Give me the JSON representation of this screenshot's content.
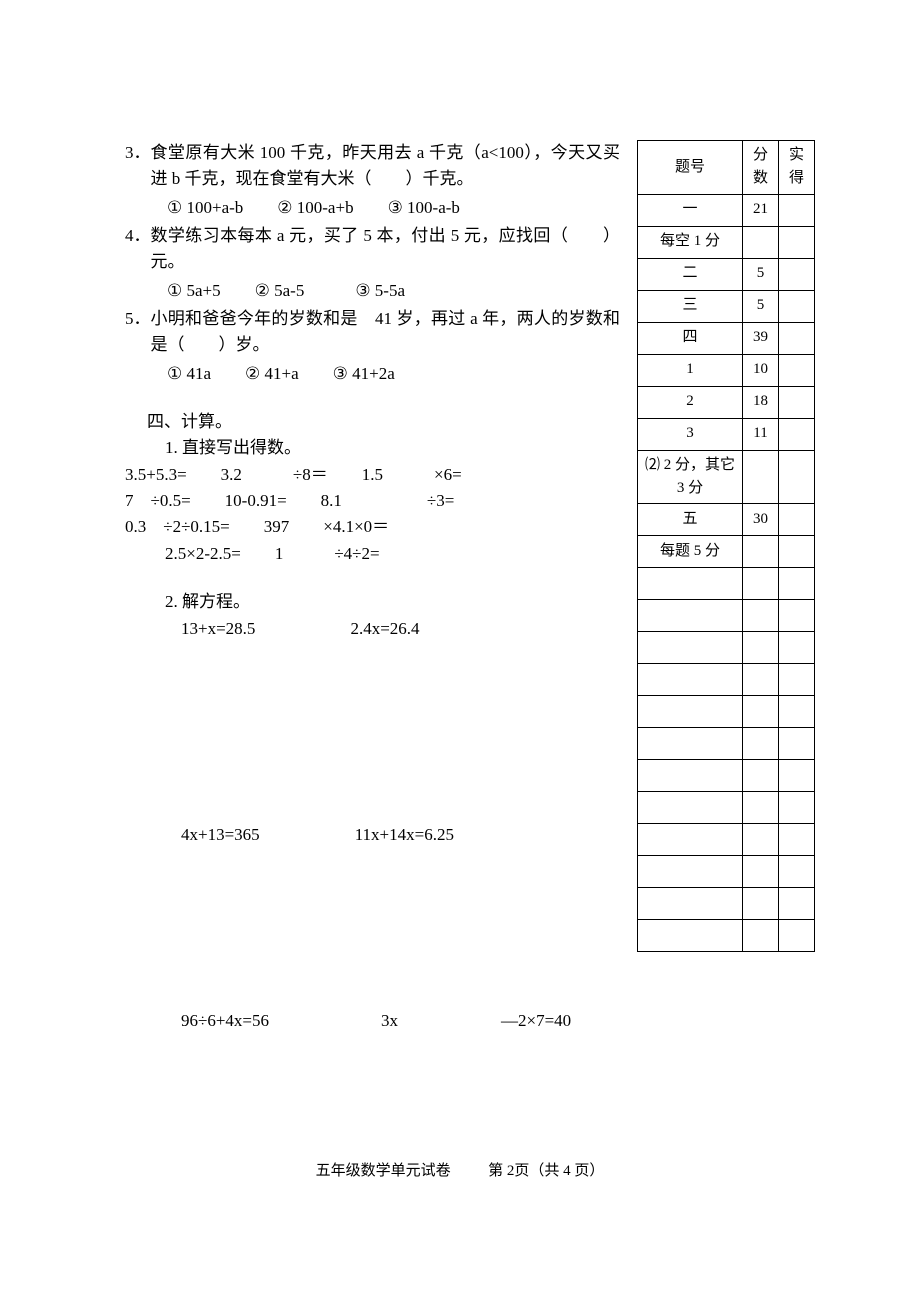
{
  "q3": {
    "num": "3．",
    "text": "食堂原有大米 100 千克，昨天用去 a 千克（a<100），今天又买进 b 千克，现在食堂有大米（　　）千克。",
    "opts": "① 100+a-b　　② 100-a+b　　③ 100-a-b"
  },
  "q4": {
    "num": "4．",
    "text": "数学练习本每本 a 元，买了 5 本，付出 5 元，应找回（　　）元。",
    "opts": "① 5a+5　　② 5a-5　　　③ 5-5a"
  },
  "q5": {
    "num": "5．",
    "text": "小明和爸爸今年的岁数和是　41 岁，再过 a 年，两人的岁数和是（　　）岁。",
    "opts": "① 41a　　② 41+a　　③ 41+2a"
  },
  "sec4": {
    "title": "四、计算。",
    "sub1": "1. 直接写出得数。",
    "line1": "3.5+5.3=　　3.2　　　÷8＝　　1.5　　　×6=",
    "line2": "7　÷0.5=　　10-0.91=　　8.1　　　　　÷3=",
    "line3": "0.3　÷2÷0.15=　　397　　×4.1×0＝",
    "line4": "2.5×2-2.5=　　1　　　÷4÷2=",
    "sub2": "2. 解方程。",
    "eq1a": "13+x=28.5",
    "eq1b": "2.4x=26.4",
    "eq2a": "4x+13=365",
    "eq2b": "11x+14x=6.25",
    "eq3a": "96÷6+4x=56",
    "eq3b": "3x",
    "eq3c": "—2×7=40"
  },
  "score": {
    "h1": "题号",
    "h2": "分数",
    "h3": "实得",
    "rows": [
      {
        "a": "一",
        "b": "21"
      },
      {
        "a": "每空 1 分",
        "b": ""
      },
      {
        "a": "二",
        "b": "5"
      },
      {
        "a": "三",
        "b": "5"
      },
      {
        "a": "四",
        "b": "39"
      },
      {
        "a": "1",
        "b": "10"
      },
      {
        "a": "2",
        "b": "18"
      },
      {
        "a": "3",
        "b": "11"
      },
      {
        "a": "⑵ 2 分，其它 3 分",
        "b": ""
      },
      {
        "a": "五",
        "b": "30"
      },
      {
        "a": "每题 5 分",
        "b": ""
      },
      {
        "a": "",
        "b": ""
      },
      {
        "a": "",
        "b": ""
      },
      {
        "a": "",
        "b": ""
      },
      {
        "a": "",
        "b": ""
      },
      {
        "a": "",
        "b": ""
      },
      {
        "a": "",
        "b": ""
      },
      {
        "a": "",
        "b": ""
      },
      {
        "a": "",
        "b": ""
      },
      {
        "a": "",
        "b": ""
      },
      {
        "a": "",
        "b": ""
      },
      {
        "a": "",
        "b": ""
      },
      {
        "a": "",
        "b": ""
      }
    ]
  },
  "footer": {
    "left": "五年级数学单元试卷",
    "right": "第 2页（共 4 页）"
  }
}
